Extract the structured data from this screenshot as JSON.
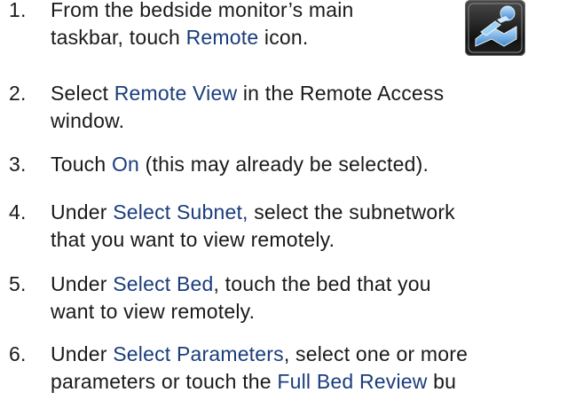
{
  "steps": [
    {
      "num": "1.",
      "lines": [
        [
          {
            "t": "From the bedside monitor’s main"
          }
        ],
        [
          {
            "t": "taskbar, touch "
          },
          {
            "t": "Remote",
            "hl": true
          },
          {
            "t": " icon."
          }
        ]
      ]
    },
    {
      "num": "2.",
      "lines": [
        [
          {
            "t": "Select "
          },
          {
            "t": "Remote View",
            "hl": true
          },
          {
            "t": " in the Remote Access"
          }
        ],
        [
          {
            "t": "window."
          }
        ]
      ]
    },
    {
      "num": "3.",
      "lines": [
        [
          {
            "t": "Touch "
          },
          {
            "t": "On",
            "hl": true
          },
          {
            "t": " (this may already be selected)."
          }
        ]
      ]
    },
    {
      "num": "4.",
      "lines": [
        [
          {
            "t": "Under "
          },
          {
            "t": "Select Subnet,",
            "hl": true
          },
          {
            "t": " select the subnetwork"
          }
        ],
        [
          {
            "t": "that you want to view remotely."
          }
        ]
      ]
    },
    {
      "num": "5.",
      "lines": [
        [
          {
            "t": "Under "
          },
          {
            "t": "Select Bed",
            "hl": true
          },
          {
            "t": ", touch the bed that you"
          }
        ],
        [
          {
            "t": "want to view remotely."
          }
        ]
      ]
    },
    {
      "num": "6.",
      "lines": [
        [
          {
            "t": "Under "
          },
          {
            "t": "Select Parameters",
            "hl": true
          },
          {
            "t": ", select one or more"
          }
        ],
        [
          {
            "t": "parameters or touch the "
          },
          {
            "t": "Full Bed Review",
            "hl": true
          },
          {
            "t": " bu"
          }
        ]
      ]
    }
  ],
  "icon": {
    "name": "remote-icon",
    "accent": "#6fb3e6"
  },
  "highlight_color": "#1a3d7c"
}
